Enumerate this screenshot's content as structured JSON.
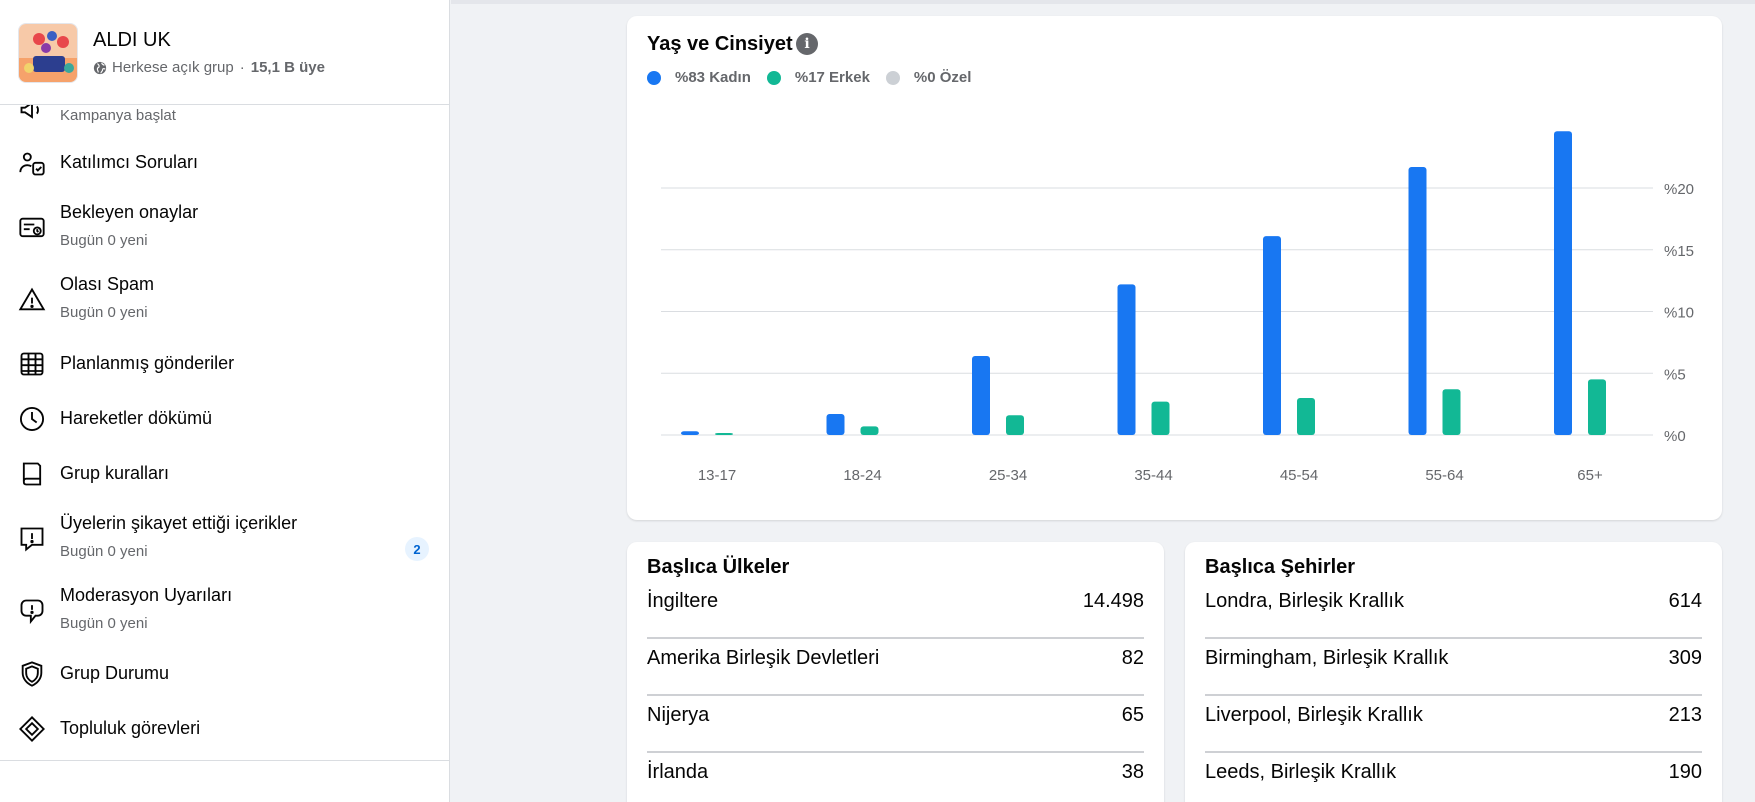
{
  "group": {
    "name": "ALDI UK",
    "privacy": "Herkese açık grup",
    "separator": "·",
    "members": "15,1 B üye"
  },
  "sidebar": {
    "items": [
      {
        "label": "",
        "sub": "Kampanya başlat",
        "icon": "megaphone-icon"
      },
      {
        "label": "Katılımcı Soruları",
        "sub": "",
        "icon": "person-question-icon"
      },
      {
        "label": "Bekleyen onaylar",
        "sub": "Bugün 0 yeni",
        "icon": "pending-icon"
      },
      {
        "label": "Olası Spam",
        "sub": "Bugün 0 yeni",
        "icon": "warning-icon"
      },
      {
        "label": "Planlanmış gönderiler",
        "sub": "",
        "icon": "calendar-icon"
      },
      {
        "label": "Hareketler dökümü",
        "sub": "",
        "icon": "clock-icon"
      },
      {
        "label": "Grup kuralları",
        "sub": "",
        "icon": "book-icon"
      },
      {
        "label": "Üyelerin şikayet ettiği içerikler",
        "sub": "Bugün 0 yeni",
        "icon": "report-icon",
        "badge": "2"
      },
      {
        "label": "Moderasyon Uyarıları",
        "sub": "Bugün 0 yeni",
        "icon": "alert-bubble-icon"
      },
      {
        "label": "Grup Durumu",
        "sub": "",
        "icon": "shield-icon"
      },
      {
        "label": "Topluluk görevleri",
        "sub": "",
        "icon": "diamond-icon"
      }
    ]
  },
  "age_gender": {
    "title": "Yaş ve Cinsiyet",
    "info_icon": "i",
    "legend": [
      {
        "label": "%83 Kadın",
        "color": "#1877f2"
      },
      {
        "label": "%17 Erkek",
        "color": "#12b895"
      },
      {
        "label": "%0 Özel",
        "color": "#ccd0d5"
      }
    ]
  },
  "chart_data": {
    "type": "bar",
    "title": "Yaş ve Cinsiyet",
    "categories": [
      "13-17",
      "18-24",
      "25-34",
      "35-44",
      "45-54",
      "55-64",
      "65+"
    ],
    "series": [
      {
        "name": "%83 Kadın",
        "color": "#1877f2",
        "values": [
          0.3,
          1.7,
          6.4,
          12.2,
          16.1,
          21.7,
          24.6
        ]
      },
      {
        "name": "%17 Erkek",
        "color": "#12b895",
        "values": [
          0.1,
          0.7,
          1.6,
          2.7,
          3.0,
          3.7,
          4.5
        ]
      }
    ],
    "yticks": [
      "%0",
      "%5",
      "%10",
      "%15",
      "%20"
    ],
    "ylim": [
      0,
      25
    ],
    "grid": true,
    "legend": "top-left"
  },
  "countries": {
    "title": "Başlıca Ülkeler",
    "rows": [
      {
        "name": "İngiltere",
        "value": "14.498"
      },
      {
        "name": "Amerika Birleşik Devletleri",
        "value": "82"
      },
      {
        "name": "Nijerya",
        "value": "65"
      },
      {
        "name": "İrlanda",
        "value": "38"
      }
    ]
  },
  "cities": {
    "title": "Başlıca Şehirler",
    "rows": [
      {
        "name": "Londra, Birleşik Krallık",
        "value": "614"
      },
      {
        "name": "Birmingham, Birleşik Krallık",
        "value": "309"
      },
      {
        "name": "Liverpool, Birleşik Krallık",
        "value": "213"
      },
      {
        "name": "Leeds, Birleşik Krallık",
        "value": "190"
      }
    ]
  }
}
